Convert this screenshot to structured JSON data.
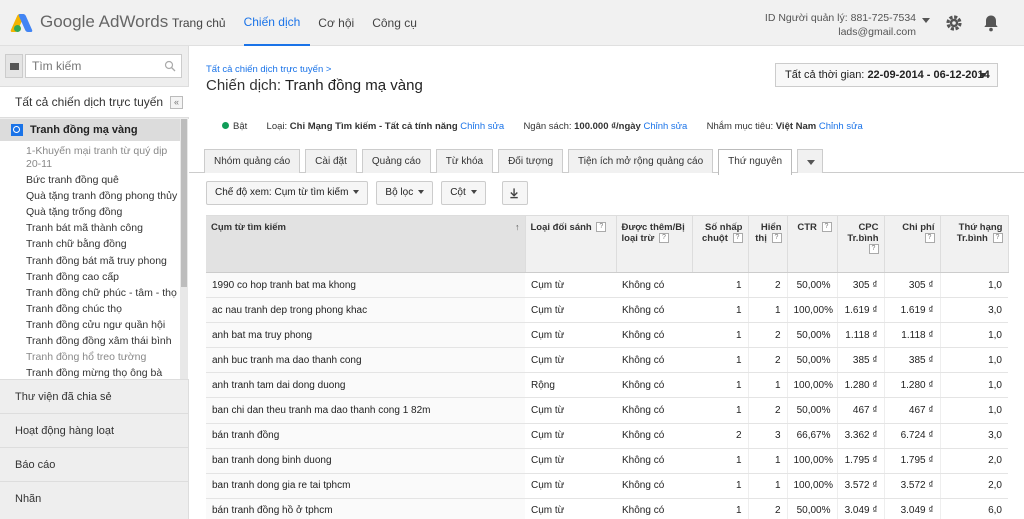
{
  "app": {
    "logo_google": "Google",
    "logo_product": "AdWords"
  },
  "topnav": [
    {
      "label": "Trang chủ",
      "active": false
    },
    {
      "label": "Chiến dịch",
      "active": true
    },
    {
      "label": "Cơ hội",
      "active": false
    },
    {
      "label": "Công cụ",
      "active": false
    }
  ],
  "account": {
    "id_line": "ID Người quản lý: 881-725-7534",
    "email": "lads@gmail.com"
  },
  "sidebar": {
    "search_placeholder": "Tìm kiếm",
    "all_campaigns": "Tất cả chiến dịch trực tuyến",
    "collapse": "«",
    "current_campaign": "Tranh đồng mạ vàng",
    "adgroups": [
      {
        "label": "1-Khuyến mại tranh từ quý dịp 20-11",
        "muted": true
      },
      {
        "label": "Bức tranh đồng quê",
        "muted": false
      },
      {
        "label": "Quà tặng tranh đồng phong thủy",
        "muted": false
      },
      {
        "label": "Quà tặng trống đồng",
        "muted": false
      },
      {
        "label": "Tranh bát mã thành công",
        "muted": false
      },
      {
        "label": "Tranh chữ bằng đồng",
        "muted": false
      },
      {
        "label": "Tranh đồng bát mã truy phong",
        "muted": false
      },
      {
        "label": "Tranh đồng cao cấp",
        "muted": false
      },
      {
        "label": "Tranh đồng chữ phúc - tâm - thọ",
        "muted": false
      },
      {
        "label": "Tranh đồng chúc thọ",
        "muted": false
      },
      {
        "label": "Tranh đồng cửu ngư quần hội",
        "muted": false
      },
      {
        "label": "Tranh đồng đồng xâm thái bình",
        "muted": false
      },
      {
        "label": "Tranh đồng hổ treo tường",
        "muted": true
      },
      {
        "label": "Tranh đồng mừng thọ ông bà",
        "muted": false
      }
    ],
    "sections": [
      "Thư viện đã chia sẻ",
      "Hoạt động hàng loạt",
      "Báo cáo",
      "Nhãn"
    ]
  },
  "header": {
    "breadcrumb": "Tất cả chiến dịch trực tuyến >",
    "campaign_label": "Chiến dịch:",
    "campaign_name": "Tranh đồng mạ vàng",
    "date_label": "Tất cả thời gian:",
    "date_value": "22-09-2014 - 06-12-2014"
  },
  "status": {
    "state": "Bật",
    "type_label": "Loại:",
    "type_value": "Chỉ Mạng Tìm kiếm - Tất cả tính năng",
    "edit": "Chỉnh sửa",
    "budget_label": "Ngân sách:",
    "budget_value": "100.000 ₫/ngày",
    "target_label": "Nhắm mục tiêu:",
    "target_value": "Việt Nam"
  },
  "tabs": [
    {
      "label": "Nhóm quảng cáo",
      "active": false
    },
    {
      "label": "Cài đặt",
      "active": false
    },
    {
      "label": "Quảng cáo",
      "active": false
    },
    {
      "label": "Từ khóa",
      "active": false
    },
    {
      "label": "Đối tượng",
      "active": false
    },
    {
      "label": "Tiện ích mở rộng quảng cáo",
      "active": false
    },
    {
      "label": "Thứ nguyên",
      "active": true
    }
  ],
  "toolbar": {
    "view_mode": "Chế độ xem: Cụm từ tìm kiếm",
    "filter": "Bộ lọc",
    "columns": "Cột"
  },
  "table": {
    "headers": {
      "term": "Cụm từ tìm kiếm",
      "match": "Loại đối sánh",
      "added": "Được thêm/Bị loại trừ",
      "clicks": "Số nhấp chuột",
      "impr": "Hiển thị",
      "ctr": "CTR",
      "cpc": "CPC Tr.bình",
      "cost": "Chi phí",
      "pos": "Thứ hạng Tr.bình",
      "help": "?",
      "sort": "↑"
    },
    "rows": [
      {
        "term": "1990 co hop tranh bat ma khong",
        "match": "Cụm từ",
        "added": "Không có",
        "clicks": "1",
        "impr": "2",
        "ctr": "50,00%",
        "cpc": "305 ₫",
        "cost": "305 ₫",
        "pos": "1,0"
      },
      {
        "term": "ac nau tranh dep trong phong khac",
        "match": "Cụm từ",
        "added": "Không có",
        "clicks": "1",
        "impr": "1",
        "ctr": "100,00%",
        "cpc": "1.619 ₫",
        "cost": "1.619 ₫",
        "pos": "3,0"
      },
      {
        "term": "anh bat ma truy phong",
        "match": "Cụm từ",
        "added": "Không có",
        "clicks": "1",
        "impr": "2",
        "ctr": "50,00%",
        "cpc": "1.118 ₫",
        "cost": "1.118 ₫",
        "pos": "1,0"
      },
      {
        "term": "anh buc tranh ma dao thanh cong",
        "match": "Cụm từ",
        "added": "Không có",
        "clicks": "1",
        "impr": "2",
        "ctr": "50,00%",
        "cpc": "385 ₫",
        "cost": "385 ₫",
        "pos": "1,0"
      },
      {
        "term": "anh tranh tam dai dong duong",
        "match": "Rộng",
        "added": "Không có",
        "clicks": "1",
        "impr": "1",
        "ctr": "100,00%",
        "cpc": "1.280 ₫",
        "cost": "1.280 ₫",
        "pos": "1,0"
      },
      {
        "term": "ban chi dan theu tranh ma dao thanh cong 1 82m",
        "match": "Cụm từ",
        "added": "Không có",
        "clicks": "1",
        "impr": "2",
        "ctr": "50,00%",
        "cpc": "467 ₫",
        "cost": "467 ₫",
        "pos": "1,0"
      },
      {
        "term": "bán tranh đồng",
        "match": "Cụm từ",
        "added": "Không có",
        "clicks": "2",
        "impr": "3",
        "ctr": "66,67%",
        "cpc": "3.362 ₫",
        "cost": "6.724 ₫",
        "pos": "3,0"
      },
      {
        "term": "ban tranh dong binh duong",
        "match": "Cụm từ",
        "added": "Không có",
        "clicks": "1",
        "impr": "1",
        "ctr": "100,00%",
        "cpc": "1.795 ₫",
        "cost": "1.795 ₫",
        "pos": "2,0"
      },
      {
        "term": "ban tranh dong gia re tai tphcm",
        "match": "Cụm từ",
        "added": "Không có",
        "clicks": "1",
        "impr": "1",
        "ctr": "100,00%",
        "cpc": "3.572 ₫",
        "cost": "3.572 ₫",
        "pos": "2,0"
      },
      {
        "term": "bán tranh đồng hồ ở tphcm",
        "match": "Cụm từ",
        "added": "Không có",
        "clicks": "1",
        "impr": "2",
        "ctr": "50,00%",
        "cpc": "3.049 ₫",
        "cost": "3.049 ₫",
        "pos": "6,0"
      }
    ]
  },
  "colors": {
    "accent": "#1a73e8",
    "status_on": "#0f9d58"
  }
}
